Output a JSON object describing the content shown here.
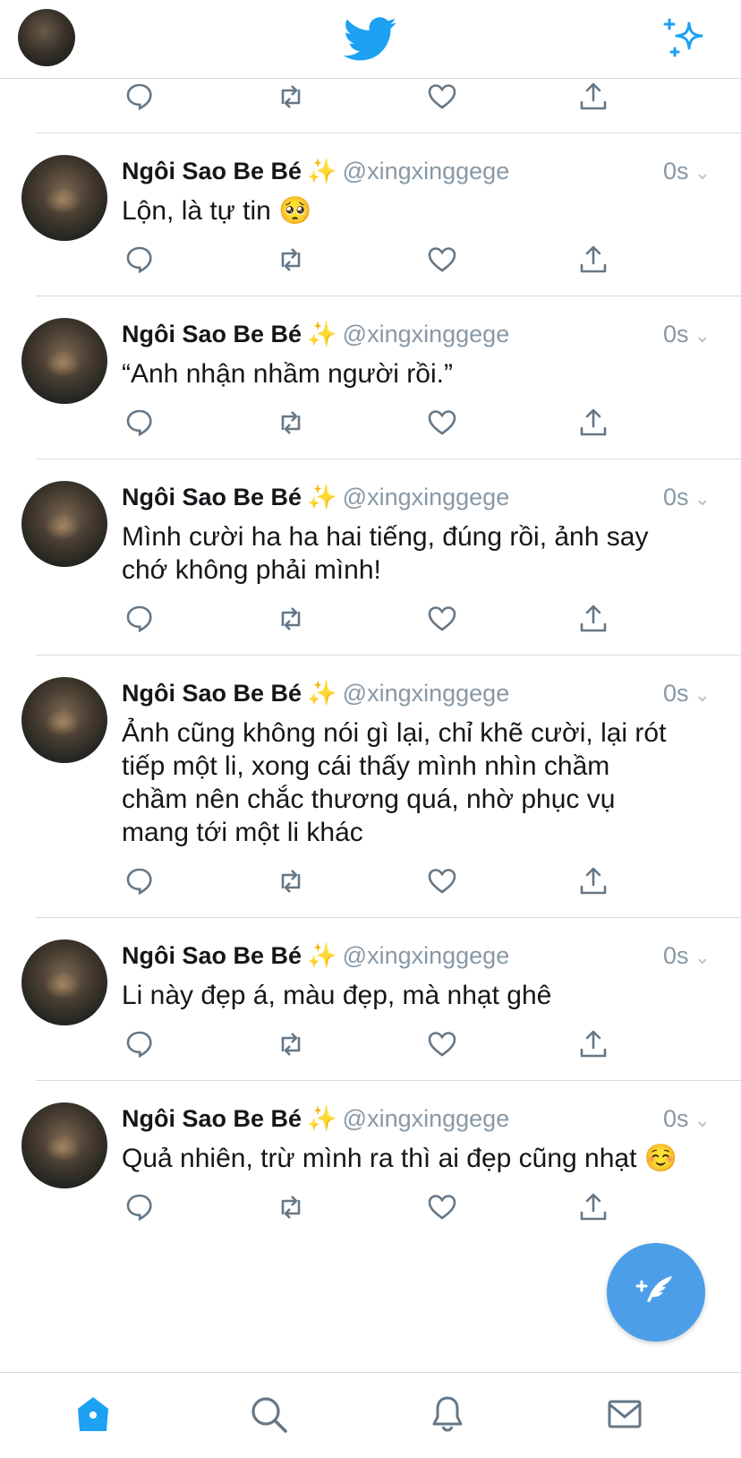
{
  "header": {
    "profile_avatar": "profile-avatar",
    "logo_icon": "twitter-bird-icon",
    "top_right_icon": "sparkle-icon",
    "accent_color": "#1DA1F2"
  },
  "feed": {
    "tweets": [
      {
        "name": "Ngôi Sao Be Bé",
        "emoji": "✨",
        "handle": "@xingxinggege",
        "time": "0s",
        "text": "Lộn, là tự tin 🥺"
      },
      {
        "name": "Ngôi Sao Be Bé",
        "emoji": "✨",
        "handle": "@xingxinggege",
        "time": "0s",
        "text": "“Anh nhận nhầm người rồi.”"
      },
      {
        "name": "Ngôi Sao Be Bé",
        "emoji": "✨",
        "handle": "@xingxinggege",
        "time": "0s",
        "text": "Mình cười ha ha hai tiếng, đúng rồi, ảnh say chớ không phải mình!"
      },
      {
        "name": "Ngôi Sao Be Bé",
        "emoji": "✨",
        "handle": "@xingxinggege",
        "time": "0s",
        "text": "Ảnh cũng không nói gì lại, chỉ khẽ cười, lại rót tiếp một li, xong cái thấy mình nhìn chầm chầm nên chắc thương quá, nhờ phục vụ mang tới một li khác"
      },
      {
        "name": "Ngôi Sao Be Bé",
        "emoji": "✨",
        "handle": "@xingxinggege",
        "time": "0s",
        "text": "Li này đẹp á, màu đẹp, mà nhạt ghê"
      },
      {
        "name": "Ngôi Sao Be Bé",
        "emoji": "✨",
        "handle": "@xingxinggege",
        "time": "0s",
        "text": "Quả nhiên, trừ mình ra thì ai đẹp cũng nhạt ☺️"
      }
    ]
  },
  "tabbar": {
    "tabs": [
      "home-icon",
      "search-icon",
      "notifications-icon",
      "messages-icon"
    ],
    "active_color": "#1DA1F2",
    "inactive_color": "#657786"
  },
  "fab": {
    "icon": "compose-tweet-icon",
    "color": "#4C9EE8"
  }
}
